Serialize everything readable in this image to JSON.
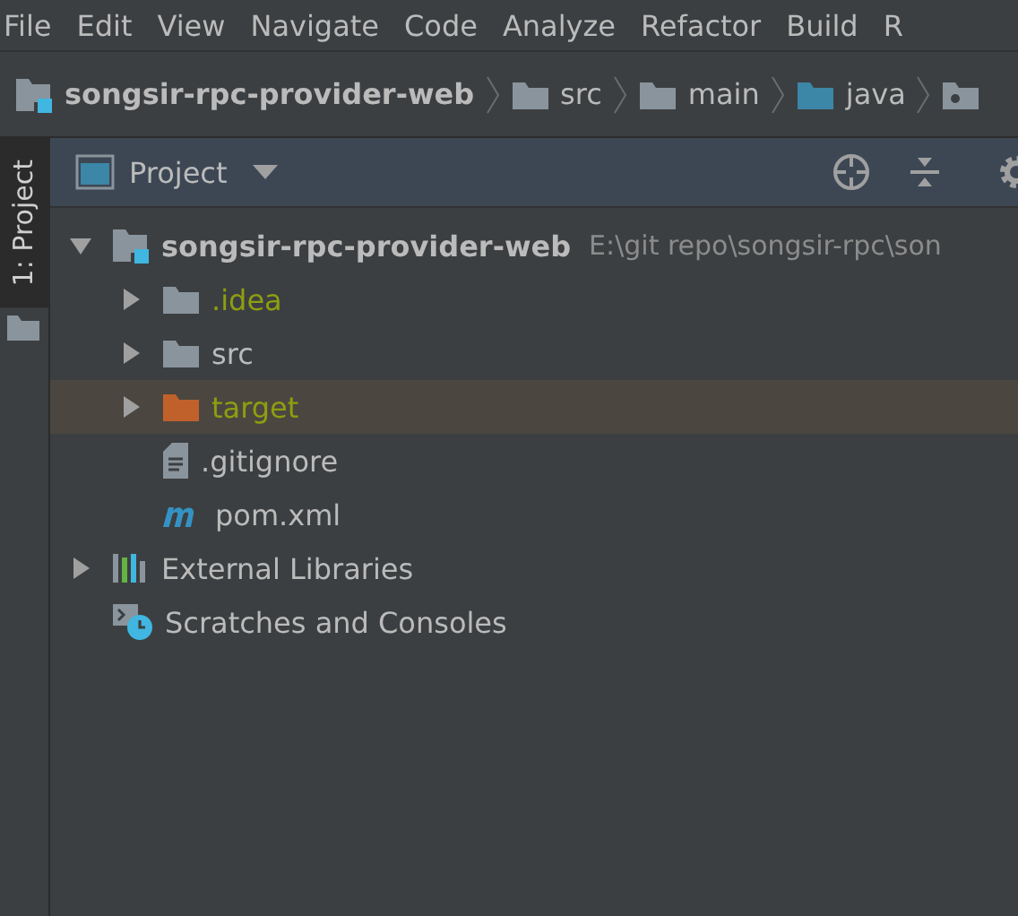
{
  "menu": [
    "File",
    "Edit",
    "View",
    "Navigate",
    "Code",
    "Analyze",
    "Refactor",
    "Build",
    "R"
  ],
  "breadcrumbs": [
    {
      "label": "songsir-rpc-provider-web",
      "kind": "module"
    },
    {
      "label": "src",
      "kind": "folder"
    },
    {
      "label": "main",
      "kind": "folder"
    },
    {
      "label": "java",
      "kind": "source"
    },
    {
      "kind": "package"
    }
  ],
  "tool_stripe": [
    {
      "label": "1: Project",
      "selected": true
    }
  ],
  "panel": {
    "title": "Project"
  },
  "tree": [
    {
      "label": "songsir-rpc-provider-web",
      "path": "E:\\git repo\\songsir-rpc\\son",
      "kind": "module",
      "expanded": true,
      "selected": false,
      "excluded": false,
      "children": [
        {
          "label": ".idea",
          "kind": "folder",
          "expanded": false,
          "selected": false,
          "excluded": true
        },
        {
          "label": "src",
          "kind": "folder",
          "expanded": false,
          "selected": false,
          "excluded": false
        },
        {
          "label": "target",
          "kind": "excluded-folder",
          "expanded": false,
          "selected": true,
          "excluded": true
        },
        {
          "label": ".gitignore",
          "kind": "file",
          "selected": false,
          "excluded": false
        },
        {
          "label": "pom.xml",
          "kind": "maven",
          "selected": false,
          "excluded": false
        }
      ]
    },
    {
      "label": "External Libraries",
      "kind": "libraries",
      "expanded": false,
      "selected": false,
      "excluded": false
    },
    {
      "label": "Scratches and Consoles",
      "kind": "scratches",
      "selected": false,
      "excluded": false
    }
  ]
}
